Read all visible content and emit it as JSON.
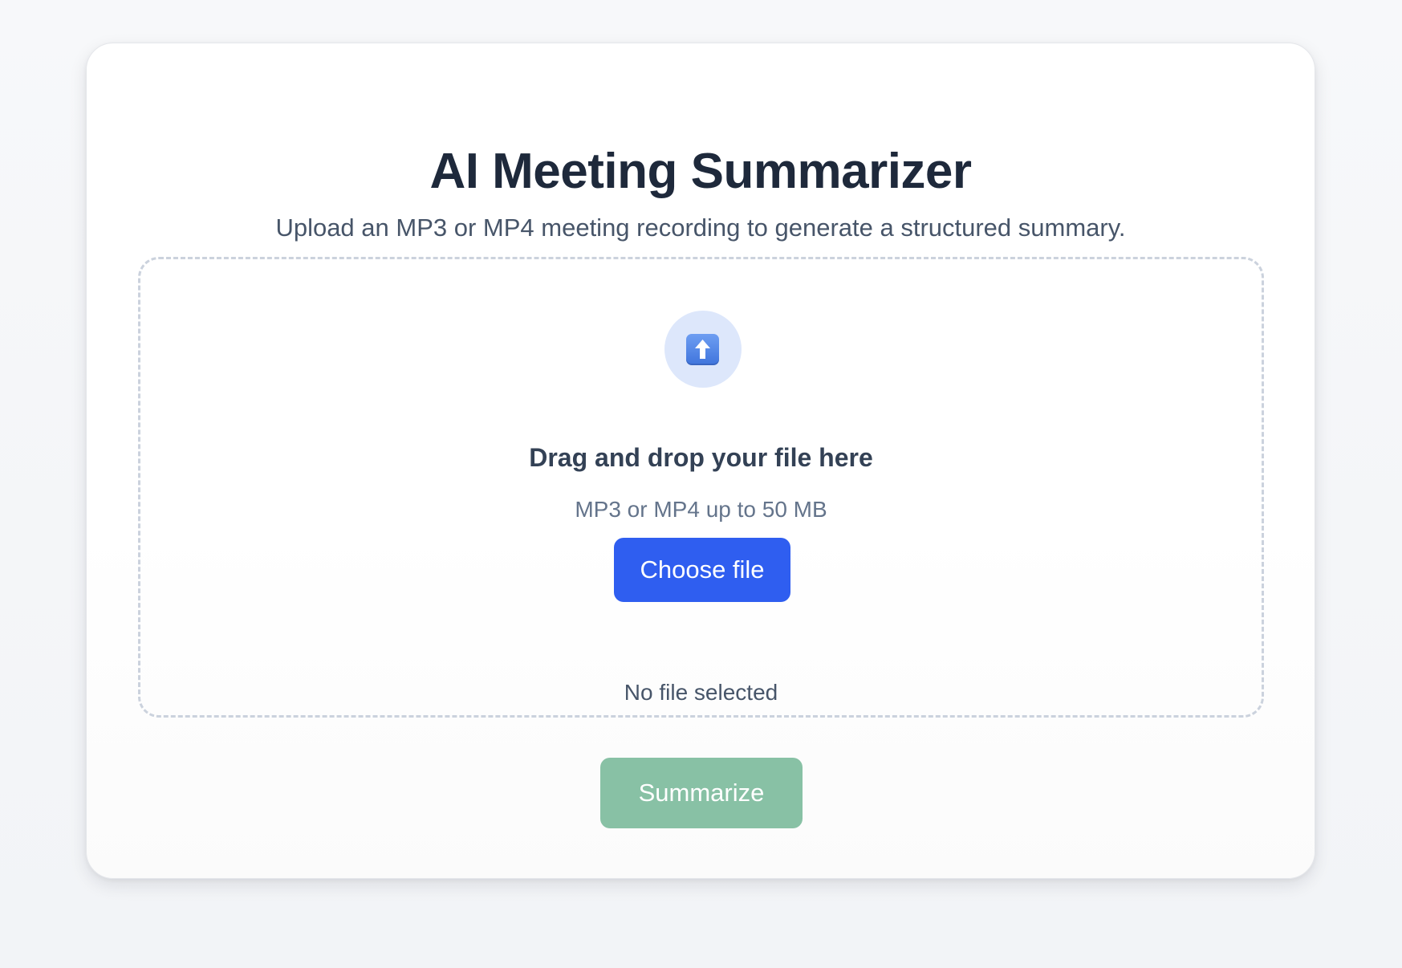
{
  "header": {
    "title": "AI Meeting Summarizer",
    "subtitle": "Upload an MP3 or MP4 meeting recording to generate a structured summary."
  },
  "dropzone": {
    "icon": "upload-arrow-icon",
    "heading": "Drag and drop your file here",
    "hint": "MP3 or MP4 up to 50 MB",
    "choose_label": "Choose file",
    "file_status": "No file selected"
  },
  "actions": {
    "summarize_label": "Summarize",
    "summarize_enabled": false
  },
  "colors": {
    "primary": "#2f5ef0",
    "summarize_disabled": "#88c1a5",
    "title": "#1e293b"
  }
}
